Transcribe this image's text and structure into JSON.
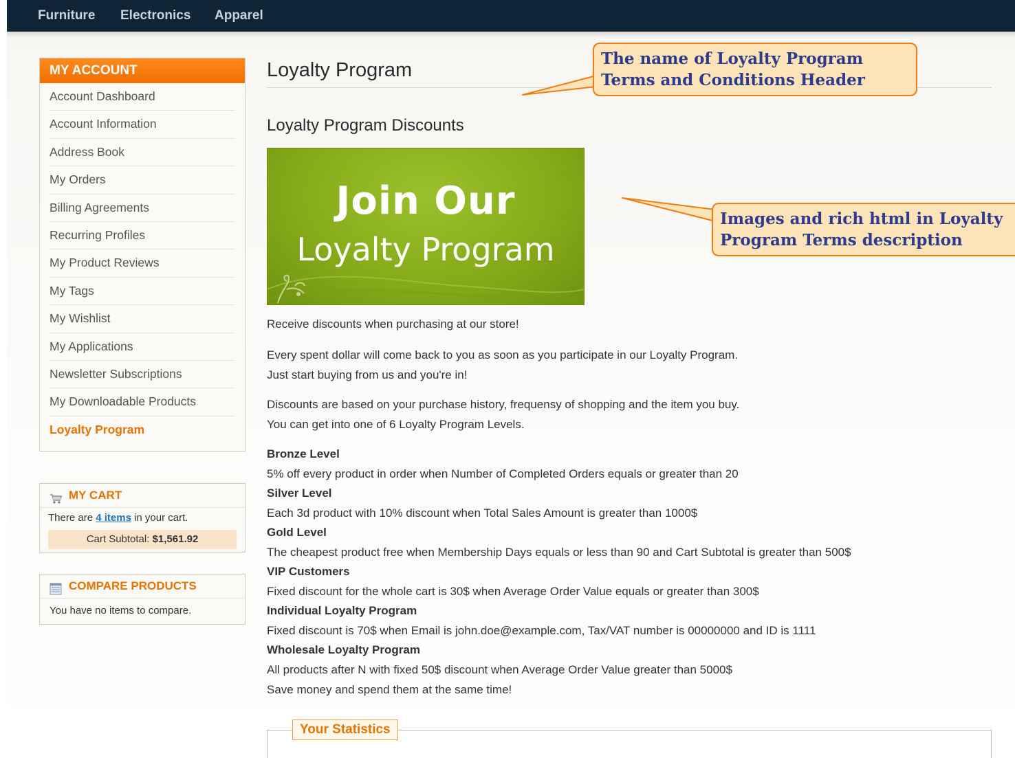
{
  "top_nav": {
    "items": [
      "Furniture",
      "Electronics",
      "Apparel"
    ]
  },
  "sidebar": {
    "account": {
      "title": "MY ACCOUNT",
      "items": [
        "Account Dashboard",
        "Account Information",
        "Address Book",
        "My Orders",
        "Billing Agreements",
        "Recurring Profiles",
        "My Product Reviews",
        "My Tags",
        "My Wishlist",
        "My Applications",
        "Newsletter Subscriptions",
        "My Downloadable Products",
        "Loyalty Program"
      ],
      "active": "Loyalty Program"
    },
    "cart": {
      "title": "MY CART",
      "text_before": "There are",
      "items_link": "4 items",
      "text_after": "in your cart.",
      "subtotal_label": "Cart Subtotal:",
      "subtotal_value": "$1,561.92"
    },
    "compare": {
      "title": "COMPARE PRODUCTS",
      "text": "You have no items to compare."
    }
  },
  "main": {
    "title": "Loyalty Program",
    "subtitle": "Loyalty Program Discounts",
    "banner": {
      "line1": "Join Our",
      "line2": "Loyalty Program"
    },
    "intro": "Receive discounts when purchasing at our store!",
    "para2": [
      "Every spent dollar will come back to you as soon as you participate in our Loyalty Program.",
      "Just start buying from us and you're in!"
    ],
    "para3": [
      "Discounts are based on your purchase history, frequensy of shopping and the item you buy.",
      "You can get into one of 6 Loyalty Program Levels."
    ],
    "levels": [
      {
        "name": "Bronze Level",
        "desc": "5% off every product in order when Number of Completed Orders equals or greater than 20"
      },
      {
        "name": "Silver Level",
        "desc": "Each 3d product with 10% discount when Total Sales Amount is greater than 1000$"
      },
      {
        "name": "Gold Level",
        "desc": "The cheapest product free when Membership Days equals or less than 90 and Cart Subtotal is greater than 500$"
      },
      {
        "name": "VIP Customers",
        "desc": "Fixed discount for the whole cart is 30$ when Average Order Value equals or greater than 300$"
      },
      {
        "name": "Individual Loyalty Program",
        "desc": "Fixed discount is 70$ when Email is john.doe@example.com, Tax/VAT number is 00000000 and ID is 1111"
      },
      {
        "name": "Wholesale Loyalty Program",
        "desc": "All products after N with fixed 50$ discount when Average Order Value greater than 5000$"
      }
    ],
    "closing": "Save money and spend them at the same time!",
    "stats_legend": "Your Statistics"
  },
  "callouts": {
    "header": [
      "The name of Loyalty Program",
      "Terms and Conditions Header"
    ],
    "description": [
      "Images and rich html in Loyalty",
      "Program Terms description"
    ]
  },
  "colors": {
    "accent": "#f07d12",
    "nav_bg": "#0f2536",
    "banner_green": "#86ac1a",
    "callout_text": "#2e3a8c"
  }
}
